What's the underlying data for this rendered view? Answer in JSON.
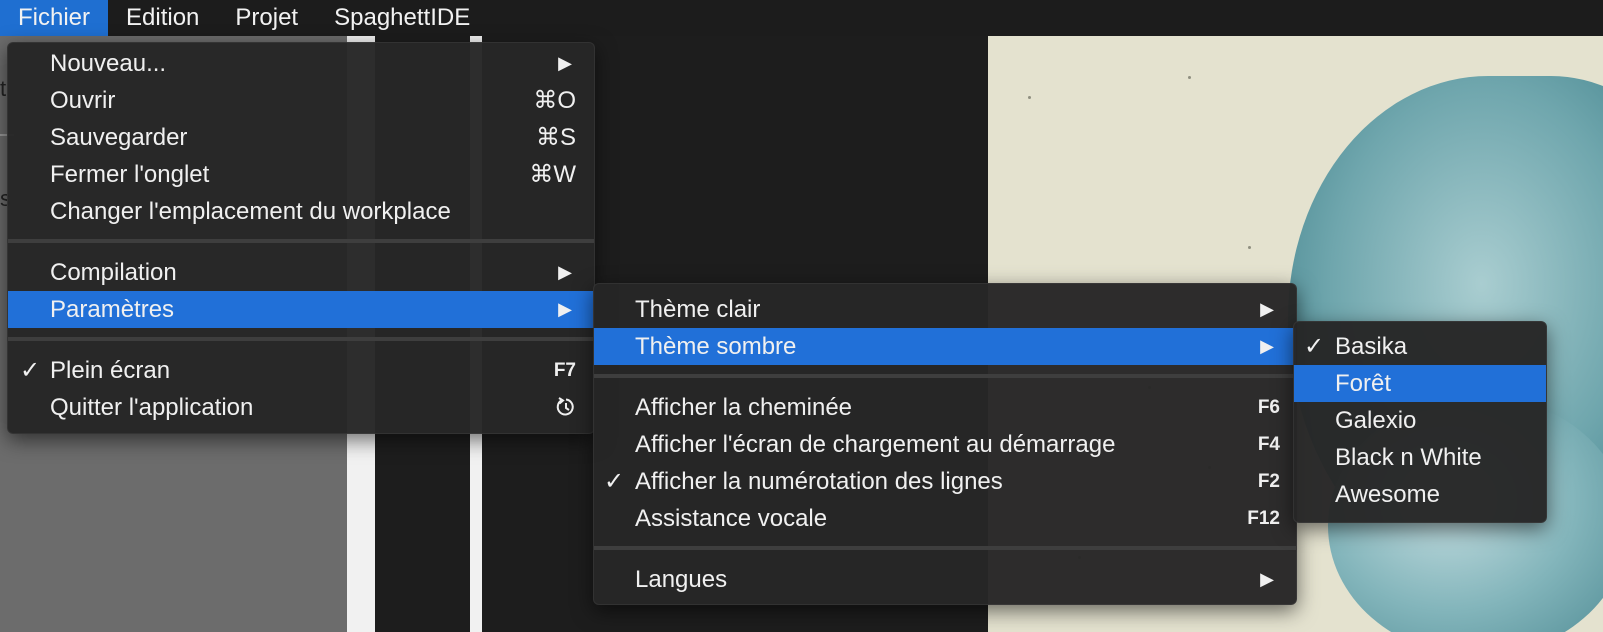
{
  "menubar": {
    "items": [
      {
        "label": "Fichier",
        "active": true
      },
      {
        "label": "Edition",
        "active": false
      },
      {
        "label": "Projet",
        "active": false
      },
      {
        "label": "SpaghettIDE",
        "active": false
      }
    ]
  },
  "fichier_menu": {
    "items": [
      {
        "label": "Nouveau...",
        "submenu": true
      },
      {
        "label": "Ouvrir",
        "shortcut": "⌘O"
      },
      {
        "label": "Sauvegarder",
        "shortcut": "⌘S"
      },
      {
        "label": "Fermer l'onglet",
        "shortcut": "⌘W"
      },
      {
        "label": "Changer l'emplacement du workplace"
      },
      {
        "label": "Compilation",
        "submenu": true
      },
      {
        "label": "Paramètres",
        "submenu": true,
        "highlighted": true
      },
      {
        "label": "Plein écran",
        "checked": true,
        "shortcut": "F7"
      },
      {
        "label": "Quitter l'application",
        "icon": "restart-icon"
      }
    ]
  },
  "parametres_menu": {
    "items": [
      {
        "label": "Thème clair",
        "submenu": true
      },
      {
        "label": "Thème sombre",
        "submenu": true,
        "highlighted": true
      },
      {
        "label": "Afficher la cheminée",
        "shortcut": "F6"
      },
      {
        "label": "Afficher l'écran de chargement au démarrage",
        "shortcut": "F4"
      },
      {
        "label": "Afficher la numérotation des lignes",
        "checked": true,
        "shortcut": "F2"
      },
      {
        "label": "Assistance vocale",
        "shortcut": "F12"
      },
      {
        "label": "Langues",
        "submenu": true
      }
    ]
  },
  "theme_sombre_menu": {
    "items": [
      {
        "label": "Basika",
        "checked": true
      },
      {
        "label": "Forêt",
        "highlighted": true
      },
      {
        "label": "Galexio"
      },
      {
        "label": "Black n White"
      },
      {
        "label": "Awesome"
      }
    ]
  },
  "glyphs": {
    "check": "✓",
    "arrow": "▶"
  },
  "left_pane": {
    "glyph1": "t",
    "glyph2": "s"
  },
  "colors": {
    "highlight": "#2170d8",
    "menubar_active": "#1f6fd1",
    "menu_bg": "#262626"
  }
}
